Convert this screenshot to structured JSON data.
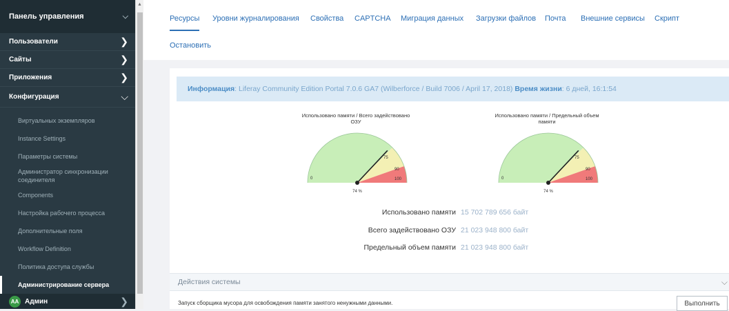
{
  "sidebar": {
    "title": "Панель управления",
    "categories": [
      {
        "label": "Пользователи"
      },
      {
        "label": "Сайты"
      },
      {
        "label": "Приложения"
      },
      {
        "label": "Конфигурация"
      }
    ],
    "items": [
      {
        "label": "Виртуальных экземпляров"
      },
      {
        "label": "Instance Settings"
      },
      {
        "label": "Параметры системы"
      },
      {
        "label": "Администратор синхронизации соединителя"
      },
      {
        "label": "Components"
      },
      {
        "label": "Настройка рабочего процесса"
      },
      {
        "label": "Дополнительные поля"
      },
      {
        "label": "Workflow Definition"
      },
      {
        "label": "Политика доступа службы"
      },
      {
        "label": "Администрирование сервера"
      }
    ],
    "user": {
      "initials": "AA",
      "name": "Админ"
    }
  },
  "tabs": [
    {
      "label": "Ресурсы"
    },
    {
      "label": "Уровни журналирования"
    },
    {
      "label": "Свойства"
    },
    {
      "label": "CAPTCHA"
    },
    {
      "label": "Миграция данных"
    },
    {
      "label": "Загрузки файлов"
    },
    {
      "label": "Почта"
    },
    {
      "label": "Внешние сервисы"
    },
    {
      "label": "Скрипт"
    },
    {
      "label": "Остановить"
    }
  ],
  "info": {
    "label": "Информация",
    "text": ": Liferay Community Edition Portal 7.0.6 GA7 (Wilberforce / Build 7006 / April 17, 2018) ",
    "uptime_label": "Время жизни",
    "uptime": ": 6 дней, 16:1:54"
  },
  "gauges": [
    {
      "title": "Использовано памяти / Всего задействовано ОЗУ",
      "value_label": "74 %",
      "value": 74,
      "tick_min": "0",
      "tick_75": "75",
      "tick_90": "90",
      "tick_100": "100"
    },
    {
      "title": "Использовано памяти / Предельный объем памяти",
      "value_label": "74 %",
      "value": 74,
      "tick_min": "0",
      "tick_75": "75",
      "tick_90": "90",
      "tick_100": "100"
    }
  ],
  "stats": [
    {
      "label": "Использовано памяти",
      "value": "15 702 789 656 байт"
    },
    {
      "label": "Всего задействовано ОЗУ",
      "value": "21 023 948 800 байт"
    },
    {
      "label": "Предельный объем памяти",
      "value": "21 023 948 800 байт"
    }
  ],
  "actions": {
    "title": "Действия системы",
    "gc_text": "Запуск сборщика мусора для освобождения памяти занятого ненужными данными.",
    "execute": "Выполнить"
  },
  "colors": {
    "sidebar": "#2a3a43",
    "accent": "#2c6fb5",
    "gauge_green": "#c8eeb8",
    "gauge_yellow": "#f3f0b4",
    "gauge_red": "#f07a7a"
  }
}
